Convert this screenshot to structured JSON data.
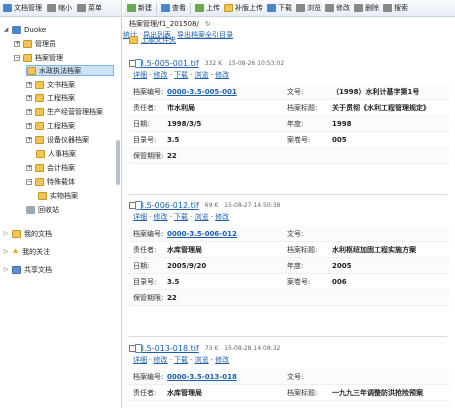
{
  "left_toolbar": {
    "items": [
      "文档管理",
      "缩小",
      "菜单"
    ]
  },
  "tree": {
    "root": "Duoke",
    "nodes": [
      {
        "label": "管理员"
      },
      {
        "label": "档案管理"
      },
      {
        "label": "水政执法档案"
      },
      {
        "label": "文书档案"
      },
      {
        "label": "工程档案"
      },
      {
        "label": "生产经营管理档案"
      },
      {
        "label": "工程档案"
      },
      {
        "label": "设备仪器档案"
      },
      {
        "label": "人事档案"
      },
      {
        "label": "会计档案"
      },
      {
        "label": "特殊载体"
      },
      {
        "label": "实物档案"
      },
      {
        "label": "回收站"
      },
      {
        "label": "我的文档"
      },
      {
        "label": "我的关注"
      },
      {
        "label": "共享文档"
      }
    ]
  },
  "right_toolbar": {
    "items": [
      "新建",
      "查看",
      "上传",
      "补版上传",
      "下载",
      "浏览",
      "修改",
      "删除",
      "搜索"
    ]
  },
  "path": {
    "text": "档案管理/f1_201508/",
    "links": [
      "统计",
      "导出列表",
      "导出档案全引目录"
    ]
  },
  "parent_link": "上级文件夹",
  "doc_actions": [
    "详细",
    "修改",
    "下载",
    "浏览",
    "修改"
  ],
  "field_labels": {
    "code": "档案编号:",
    "doc_no": "文号:",
    "owner": "责任者:",
    "title": "档案标题:",
    "date": "日期:",
    "year": "年度:",
    "dir": "目录号:",
    "vol": "案卷号:",
    "keep": "保管期限:"
  },
  "docs": [
    {
      "name": "3.5-005-001.tif",
      "size": "332 K",
      "time": "15-08-26 10:53:02",
      "code": "0000-3.5-005-001",
      "doc_no": "（1998）水利计基字第1号",
      "owner": "市水利局",
      "title": "关于贯彻《水利工程管理规定》",
      "date": "1998/3/5",
      "year": "1998",
      "dir": "3.5",
      "vol": "005",
      "keep": "22"
    },
    {
      "name": "3.5-006-012.tif",
      "size": "69 K",
      "time": "15-08-27 14:50:38",
      "code": "0000-3.5-006-012",
      "doc_no": "",
      "owner": "水库管理局",
      "title": "水利枢纽加固工程实施方案",
      "date": "2005/9/20",
      "year": "2005",
      "dir": "3.5",
      "vol": "006",
      "keep": "22"
    },
    {
      "name": "3.5-013-018.tif",
      "size": "73 K",
      "time": "15-08-28 14:08:32",
      "code": "0000-3.5-013-018",
      "doc_no": "",
      "owner": "水库管理局",
      "title": "一九九三年调整防洪抢险预案",
      "date": "",
      "year": "",
      "dir": "",
      "vol": "",
      "keep": ""
    }
  ]
}
